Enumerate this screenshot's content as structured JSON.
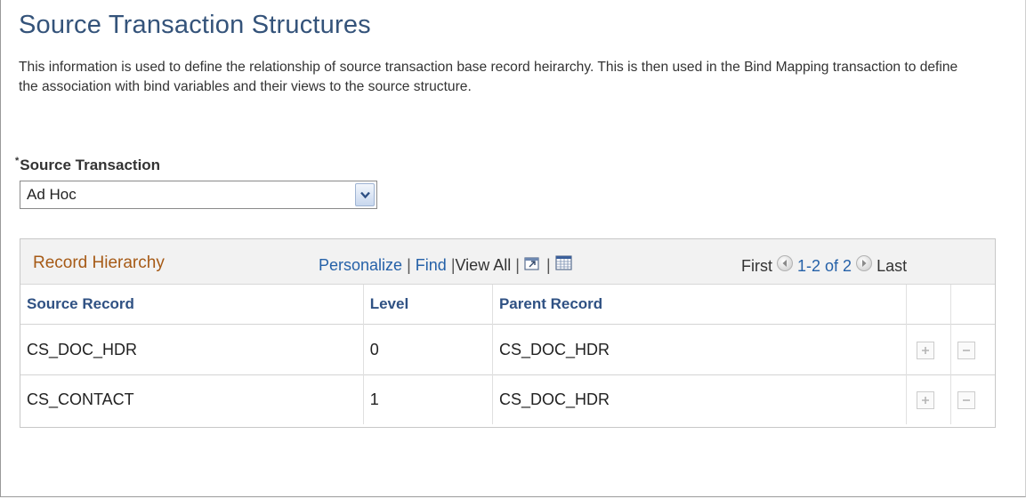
{
  "page": {
    "title": "Source Transaction Structures",
    "description": "This information is used to define the relationship of source transaction base record heirarchy. This is then used in the Bind Mapping transaction to define the association with bind variables and their views to the source structure."
  },
  "source_transaction": {
    "required_marker": "*",
    "label": "Source Transaction",
    "value": "Ad Hoc"
  },
  "grid": {
    "title": "Record Hierarchy",
    "toolbar": {
      "personalize": "Personalize",
      "separator": "|",
      "find": "Find",
      "view_all": "View All",
      "first": "First",
      "range": "1-2 of 2",
      "last": "Last"
    },
    "columns": [
      "Source Record",
      "Level",
      "Parent Record"
    ],
    "rows": [
      {
        "source_record": "CS_DOC_HDR",
        "level": "0",
        "parent_record": "CS_DOC_HDR"
      },
      {
        "source_record": "CS_CONTACT",
        "level": "1",
        "parent_record": "CS_DOC_HDR"
      }
    ]
  },
  "colors": {
    "title": "#34537a",
    "grid_title": "#a65a16",
    "link": "#2561a8",
    "column_header": "#2f5183"
  },
  "icons": {
    "dropdown": "chevron-down-icon",
    "new_window": "new-window-icon",
    "download": "spreadsheet-icon",
    "prev": "previous-arrow-icon",
    "next": "next-arrow-icon",
    "add_row": "plus-icon",
    "delete_row": "minus-icon"
  }
}
